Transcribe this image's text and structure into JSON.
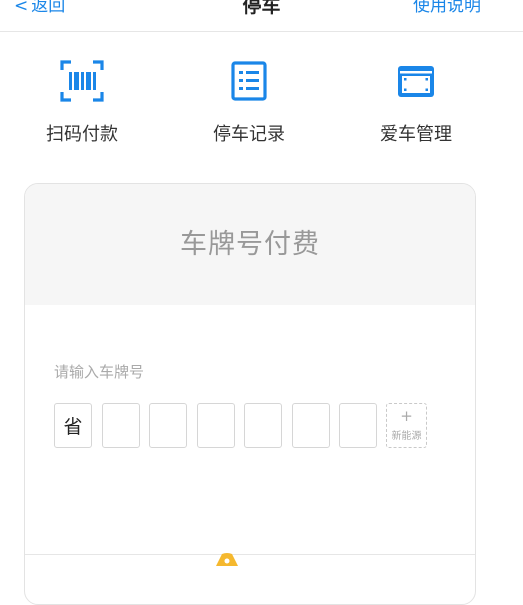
{
  "nav": {
    "back_label": "返回",
    "title": "停车",
    "help_label": "使用说明"
  },
  "quick_actions": [
    {
      "label": "扫码付款",
      "icon": "barcode-scan-icon"
    },
    {
      "label": "停车记录",
      "icon": "record-list-icon"
    },
    {
      "label": "爱车管理",
      "icon": "car-card-icon"
    }
  ],
  "card": {
    "title": "车牌号付费",
    "input_hint": "请输入车牌号",
    "province_label": "省",
    "new_energy_plus": "+",
    "new_energy_label": "新能源"
  },
  "colors": {
    "accent": "#1a86e8",
    "peek_icon": "#f5b82e"
  }
}
